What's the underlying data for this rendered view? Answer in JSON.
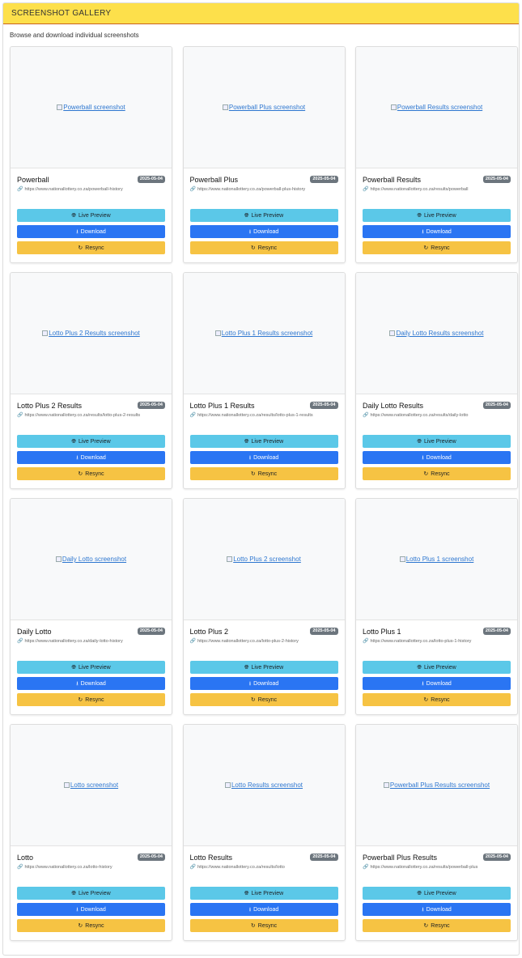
{
  "header": {
    "title": "SCREENSHOT GALLERY"
  },
  "subtitle": "Browse and download individual screenshots",
  "buttons": {
    "preview": "Live Preview",
    "download": "Download",
    "resync": "Resync"
  },
  "icons": {
    "preview": "globe-icon",
    "download": "download-icon",
    "resync": "sync-icon",
    "link": "link-icon"
  },
  "colors": {
    "header_bg": "#fde04b",
    "preview": "#5bc8e8",
    "download": "#2a75f3",
    "resync": "#f6c343",
    "badge": "#6c757d"
  },
  "cards": [
    {
      "title": "Powerball",
      "date": "2025-05-04",
      "url": "https://www.nationallottery.co.za/powerball-history",
      "alt": "Powerball screenshot"
    },
    {
      "title": "Powerball Plus",
      "date": "2025-05-04",
      "url": "https://www.nationallottery.co.za/powerball-plus-history",
      "alt": "Powerball Plus screenshot"
    },
    {
      "title": "Powerball Results",
      "date": "2025-05-04",
      "url": "https://www.nationallottery.co.za/results/powerball",
      "alt": "Powerball Results screenshot"
    },
    {
      "title": "Lotto Plus 2 Results",
      "date": "2025-05-04",
      "url": "https://www.nationallottery.co.za/results/lotto-plus-2-results",
      "alt": "Lotto Plus 2 Results screenshot"
    },
    {
      "title": "Lotto Plus 1 Results",
      "date": "2025-05-04",
      "url": "https://www.nationallottery.co.za/results/lotto-plus-1-results",
      "alt": "Lotto Plus 1 Results screenshot"
    },
    {
      "title": "Daily Lotto Results",
      "date": "2025-05-04",
      "url": "https://www.nationallottery.co.za/results/daily-lotto",
      "alt": "Daily Lotto Results screenshot"
    },
    {
      "title": "Daily Lotto",
      "date": "2025-05-04",
      "url": "https://www.nationallottery.co.za/daily-lotto-history",
      "alt": "Daily Lotto screenshot"
    },
    {
      "title": "Lotto Plus 2",
      "date": "2025-05-04",
      "url": "https://www.nationallottery.co.za/lotto-plus-2-history",
      "alt": "Lotto Plus 2 screenshot"
    },
    {
      "title": "Lotto Plus 1",
      "date": "2025-05-04",
      "url": "https://www.nationallottery.co.za/lotto-plus-1-history",
      "alt": "Lotto Plus 1 screenshot"
    },
    {
      "title": "Lotto",
      "date": "2025-05-04",
      "url": "https://www.nationallottery.co.za/lotto-history",
      "alt": "Lotto screenshot"
    },
    {
      "title": "Lotto Results",
      "date": "2025-05-04",
      "url": "https://www.nationallottery.co.za/results/lotto",
      "alt": "Lotto Results screenshot"
    },
    {
      "title": "Powerball Plus Results",
      "date": "2025-05-04",
      "url": "https://www.nationallottery.co.za/results/powerball-plus",
      "alt": "Powerball Plus Results screenshot"
    }
  ]
}
